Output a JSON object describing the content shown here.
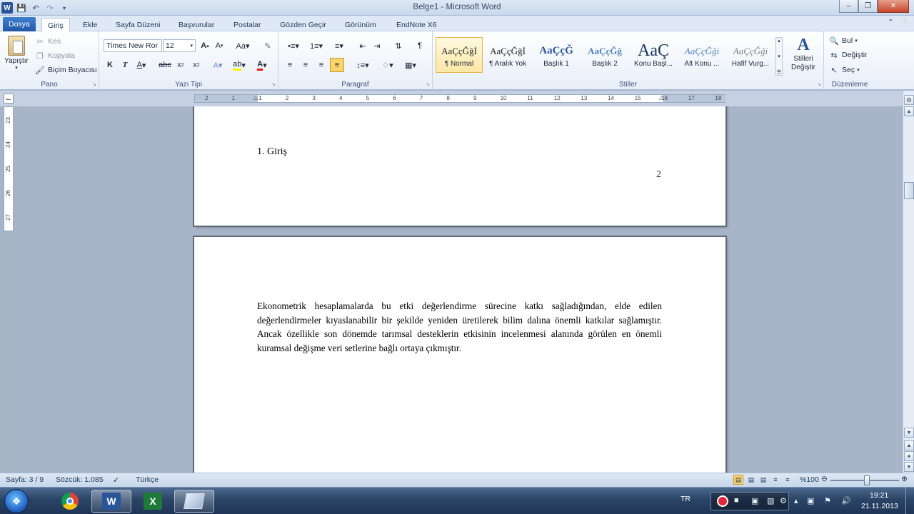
{
  "window": {
    "title": "Belge1 - Microsoft Word"
  },
  "tabs": [
    "Dosya",
    "Giriş",
    "Ekle",
    "Sayfa Düzeni",
    "Başvurular",
    "Postalar",
    "Gözden Geçir",
    "Görünüm",
    "EndNote X6"
  ],
  "active_tab": "Giriş",
  "ribbon": {
    "clipboard": {
      "label": "Pano",
      "paste": "Yapıştır",
      "cut": "Kes",
      "copy": "Kopyala",
      "format_painter": "Biçim Boyacısı"
    },
    "font": {
      "label": "Yazı Tipi",
      "font_name": "Times New Ror",
      "font_size": "12"
    },
    "paragraph": {
      "label": "Paragraf"
    },
    "styles": {
      "label": "Stiller",
      "items": [
        {
          "sample": "AaÇçĞğİ",
          "name": "¶ Normal"
        },
        {
          "sample": "AaÇçĞğİ",
          "name": "¶ Aralık Yok"
        },
        {
          "sample": "AaÇçĞ",
          "name": "Başlık 1"
        },
        {
          "sample": "AaÇçĞğ",
          "name": "Başlık 2"
        },
        {
          "sample": "AaÇ",
          "name": "Konu Başl..."
        },
        {
          "sample": "AaÇçĞği",
          "name": "Alt Konu ..."
        },
        {
          "sample": "AaÇçĞği",
          "name": "Hafif Vurg..."
        }
      ],
      "change_styles": "Stilleri Değiştir"
    },
    "editing": {
      "label": "Düzenleme",
      "find": "Bul",
      "replace": "Değiştir",
      "select": "Seç"
    }
  },
  "ruler": {
    "numbers": [
      "2",
      "1",
      "1",
      "2",
      "3",
      "4",
      "5",
      "6",
      "7",
      "8",
      "9",
      "10",
      "11",
      "12",
      "13",
      "14",
      "15",
      "16",
      "17",
      "18"
    ]
  },
  "vruler": {
    "numbers": [
      "23",
      "24",
      "25",
      "26",
      "27"
    ]
  },
  "document": {
    "page1": {
      "heading": "1. Giriş",
      "page_number": "2"
    },
    "page2": {
      "paragraph": "Ekonometrik hesaplamalarda bu etki değerlendirme sürecine katkı sağladığından, elde edilen değerlendirmeler kıyaslanabilir bir şekilde yeniden üretilerek bilim dalına önemli katkılar sağlamıştır. Ancak özellikle son dönemde tarımsal desteklerin etkisinin incelenmesi alanında görülen en önemli kuramsal değişme veri setlerine bağlı ortaya çıkmıştır."
    }
  },
  "statusbar": {
    "page": "Sayfa: 3 / 9",
    "words": "Sözcük: 1.085",
    "language": "Türkçe",
    "zoom": "%100",
    "zoom_level": 100
  },
  "taskbar": {
    "lang": "TR",
    "time": "19:21",
    "date": "21.11.2013"
  }
}
